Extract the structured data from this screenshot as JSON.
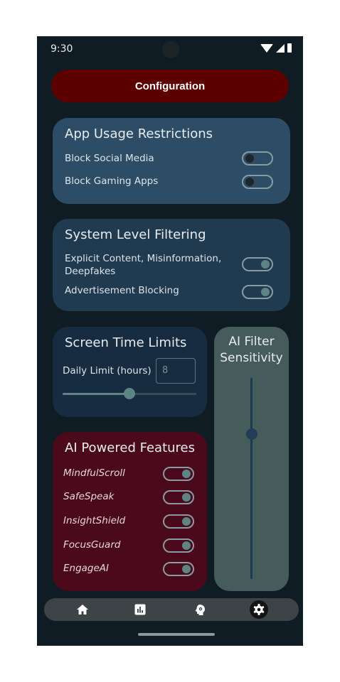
{
  "status_bar": {
    "time": "9:30"
  },
  "header": {
    "title": "Configuration"
  },
  "app_usage": {
    "title": "App Usage Restrictions",
    "items": [
      {
        "label": "Block Social Media",
        "enabled": false
      },
      {
        "label": "Block Gaming Apps",
        "enabled": false
      }
    ]
  },
  "system_filtering": {
    "title": "System Level Filtering",
    "items": [
      {
        "label": "Explicit Content, Misinformation, Deepfakes",
        "enabled": true
      },
      {
        "label": "Advertisement Blocking",
        "enabled": true
      }
    ]
  },
  "screen_time": {
    "title": "Screen Time Limits",
    "daily_label": "Daily Limit (hours)",
    "daily_value": "8",
    "slider_fraction": 0.5
  },
  "ai_features": {
    "title": "AI Powered Features",
    "items": [
      {
        "label": "MindfulScroll",
        "enabled": true
      },
      {
        "label": "SafeSpeak",
        "enabled": true
      },
      {
        "label": "InsightShield",
        "enabled": true
      },
      {
        "label": "FocusGuard",
        "enabled": true
      },
      {
        "label": "EngageAI",
        "enabled": true
      }
    ]
  },
  "ai_sensitivity": {
    "title": "AI Filter Sensitivity",
    "slider_fraction": 0.72
  },
  "nav": {
    "items": [
      {
        "icon": "home-icon",
        "active": false
      },
      {
        "icon": "stats-icon",
        "active": false
      },
      {
        "icon": "brain-icon",
        "active": false
      },
      {
        "icon": "gear-icon",
        "active": true
      }
    ]
  },
  "colors": {
    "background": "#0f1c24",
    "accent": "#5c0000",
    "toggle_on": "#5f8484"
  }
}
